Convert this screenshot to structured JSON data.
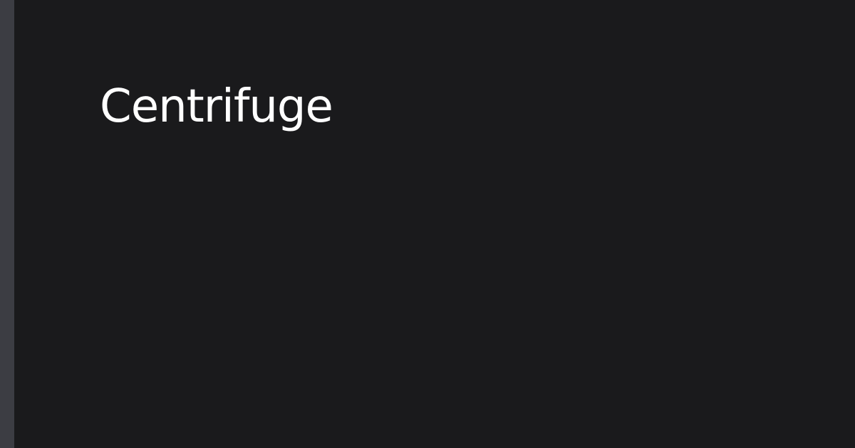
{
  "page": {
    "title": "Centrifuge"
  },
  "colors": {
    "background": "#1a1a1c",
    "left_bar": "#3c3d43",
    "title_text": "#ffffff"
  }
}
